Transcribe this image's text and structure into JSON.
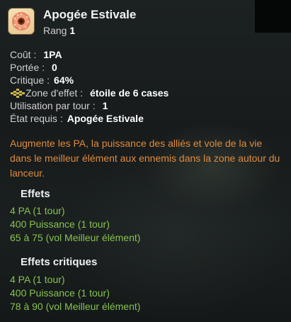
{
  "spell": {
    "name": "Apogée Estivale",
    "rank_label": "Rang",
    "rank_value": "1",
    "icon": "sun-donut-icon"
  },
  "stats": {
    "cost_label": "Coût :",
    "cost_value": "1PA",
    "range_label": "Portée :",
    "range_value": "0",
    "crit_label": "Critique :",
    "crit_value": "64%",
    "zone_label": "Zone d'effet :",
    "zone_value": "étoile de 6 cases",
    "zone_icon": "star-zone-icon",
    "uses_label": "Utilisation par tour :",
    "uses_value": "1",
    "state_label": "État requis :",
    "state_value": "Apogée Estivale"
  },
  "description": "Augmente les PA, la puissance des alliés et vole de la vie dans le meilleur élément aux ennemis dans la zone autour du lanceur.",
  "effects": {
    "title": "Effets",
    "items": [
      "4 PA (1 tour)",
      "400 Puissance (1 tour)",
      "65 à 75 (vol Meilleur élément)"
    ]
  },
  "critical_effects": {
    "title": "Effets critiques",
    "items": [
      "4 PA (1 tour)",
      "400 Puissance (1 tour)",
      "78 à 90 (vol Meilleur élément)"
    ]
  },
  "colors": {
    "description": "#e08a3c",
    "effects": "#86c24f"
  }
}
